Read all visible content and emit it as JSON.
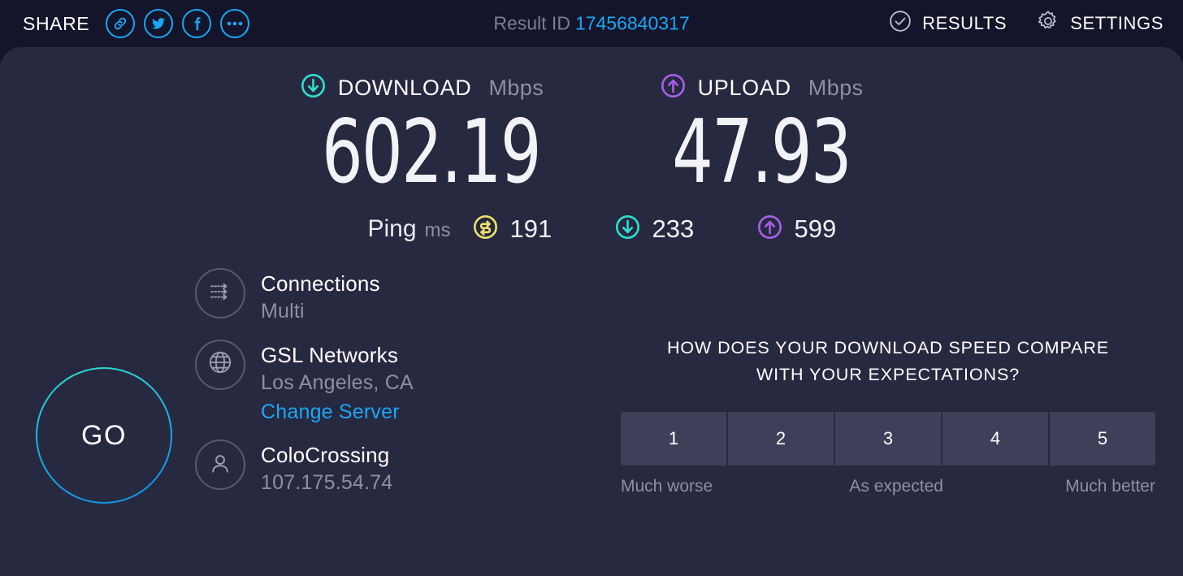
{
  "header": {
    "share_label": "SHARE",
    "share_icons": [
      {
        "name": "link-icon"
      },
      {
        "name": "twitter-icon"
      },
      {
        "name": "facebook-icon"
      },
      {
        "name": "more-options-icon"
      }
    ],
    "result_id_label": "Result ID",
    "result_id_value": "17456840317",
    "results_label": "RESULTS",
    "settings_label": "SETTINGS"
  },
  "speeds": {
    "download": {
      "name": "DOWNLOAD",
      "unit": "Mbps",
      "value": "602.19",
      "color": "#2edfcd",
      "icon": "download-arrow-icon"
    },
    "upload": {
      "name": "UPLOAD",
      "unit": "Mbps",
      "value": "47.93",
      "color": "#a95ee8",
      "icon": "upload-arrow-icon"
    }
  },
  "ping": {
    "label": "Ping",
    "unit": "ms",
    "items": [
      {
        "icon": "idle-latency-icon",
        "color": "#ede36c",
        "value": "191"
      },
      {
        "icon": "download-latency-icon",
        "color": "#2edfcd",
        "value": "233"
      },
      {
        "icon": "upload-latency-icon",
        "color": "#a95ee8",
        "value": "599"
      }
    ]
  },
  "go_button": {
    "label": "GO",
    "gradient_start": "#2edfcd",
    "gradient_end": "#0f8fe0"
  },
  "connection_info": [
    {
      "icon": "multi-connection-icon",
      "title": "Connections",
      "sub": "Multi",
      "link": null
    },
    {
      "icon": "globe-icon",
      "title": "GSL Networks",
      "sub": "Los Angeles, CA",
      "link": "Change Server"
    },
    {
      "icon": "user-icon",
      "title": "ColoCrossing",
      "sub": "107.175.54.74",
      "link": null
    }
  ],
  "survey": {
    "question_line1": "HOW DOES YOUR DOWNLOAD SPEED COMPARE",
    "question_line2": "WITH YOUR EXPECTATIONS?",
    "options": [
      "1",
      "2",
      "3",
      "4",
      "5"
    ],
    "scale_low": "Much worse",
    "scale_mid": "As expected",
    "scale_high": "Much better"
  },
  "colors": {
    "page_background": "#14152a",
    "panel_background": "#272940",
    "accent_blue": "#1ba6f5",
    "rating_button": "#3e4059"
  }
}
